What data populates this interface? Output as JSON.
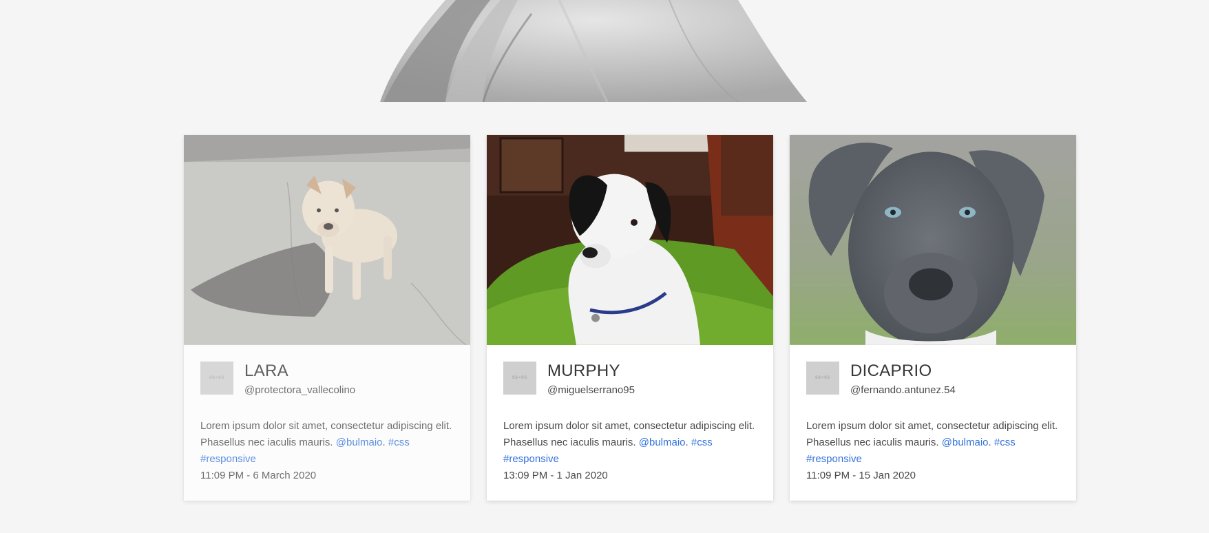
{
  "hero": {
    "image": "gray-dog-photo"
  },
  "colors": {
    "background": "#f5f5f5",
    "card": "#ffffff",
    "link": "#3273dc",
    "avatar_placeholder": "#cfcfcf"
  },
  "cards": [
    {
      "image": "tan-dog-on-concrete-photo",
      "avatar_text": "96×96",
      "name": "LARA",
      "handle": "@protectora_vallecolino",
      "text": "Lorem ipsum dolor sit amet, consectetur adipiscing elit. Phasellus nec iaculis mauris.",
      "mention": "@bulmaio",
      "tag_css": "#css",
      "tag_responsive": "#responsive",
      "time": "11:09 PM - 6 March 2020"
    },
    {
      "image": "black-white-dog-on-rug-photo",
      "avatar_text": "96×96",
      "name": "MURPHY",
      "handle": "@miguelserrano95",
      "text": "Lorem ipsum dolor sit amet, consectetur adipiscing elit. Phasellus nec iaculis mauris.",
      "mention": "@bulmaio",
      "tag_css": "#css",
      "tag_responsive": "#responsive",
      "time": "13:09 PM - 1 Jan 2020"
    },
    {
      "image": "gray-pitbull-puppy-photo",
      "avatar_text": "96×96",
      "name": "DICAPRIO",
      "handle": "@fernando.antunez.54",
      "text": "Lorem ipsum dolor sit amet, consectetur adipiscing elit. Phasellus nec iaculis mauris.",
      "mention": "@bulmaio",
      "tag_css": "#css",
      "tag_responsive": "#responsive",
      "time": "11:09 PM - 15 Jan 2020"
    }
  ]
}
